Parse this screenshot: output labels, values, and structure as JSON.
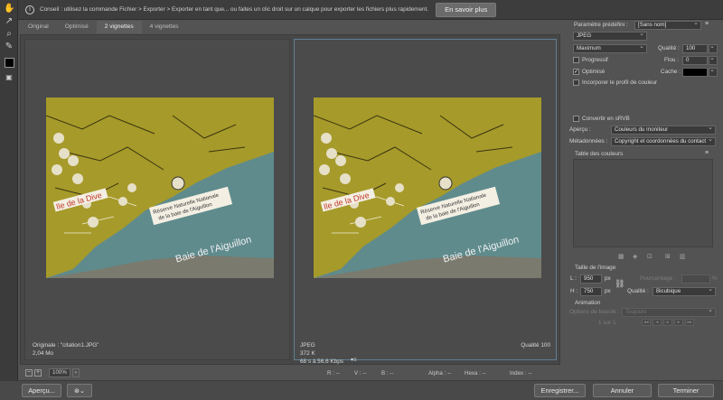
{
  "infobar": {
    "message": "Conseil : utilisez la commande Fichier > Exporter > Exporter en tant que... ou faites un clic droit sur un calque pour exporter les fichiers plus rapidement.",
    "learn_more": "En savoir plus"
  },
  "tabs": [
    "Original",
    "Optimisé",
    "2 vignettes",
    "4 vignettes"
  ],
  "active_tab": "2 vignettes",
  "photo": {
    "label_ile": "Ile de la Dive",
    "label_reserve_1": "Réserve Naturelle Nationale",
    "label_reserve_2": "de la baie de l'Aiguillon",
    "label_baie": "Baie de l'Aiguillon"
  },
  "left_pane": {
    "line1": "Originale : \"citation1.JPG\"",
    "line2": "2,04 Mo"
  },
  "right_pane": {
    "format": "JPEG",
    "size": "372 K",
    "rate": "68 s à 56,6 Kbps",
    "quality": "Qualité 100"
  },
  "status": {
    "zoom": "100%",
    "r": "R : --",
    "v": "V : --",
    "b": "B : --",
    "alpha": "Alpha : --",
    "hexa": "Hexa : --",
    "index": "Index : --"
  },
  "footer": {
    "preview": "Aperçu...",
    "save": "Enregistrer...",
    "cancel": "Annuler",
    "done": "Terminer"
  },
  "panel": {
    "preset_label": "Paramètre prédéfini :",
    "preset_value": "[Sans nom]",
    "format": "JPEG",
    "compression": "Maximum",
    "quality_label": "Qualité :",
    "quality_value": "100",
    "progressive": "Progressif",
    "progressive_checked": false,
    "blur_label": "Flou :",
    "blur_value": "0",
    "optimized": "Optimisé",
    "optimized_checked": true,
    "matte_label": "Cache :",
    "embed_profile": "Incorporer le profil de couleur",
    "embed_checked": false,
    "srgb": "Convertir en sRVB",
    "srgb_checked": false,
    "preview_label": "Aperçu :",
    "preview_value": "Couleurs du moniteur",
    "metadata_label": "Métadonnées :",
    "metadata_value": "Copyright et coordonnées du contact",
    "color_table": "Table des couleurs",
    "image_size": "Taille de l'image",
    "w_label": "L :",
    "w_value": "950",
    "h_label": "H :",
    "h_value": "750",
    "px": "px",
    "percent_label": "Pourcentage :",
    "percent_unit": "%",
    "quality2_label": "Qualité :",
    "quality2_value": "Bicubique",
    "animation": "Animation",
    "loop_label": "Options de boucle :",
    "loop_value": "Toujours",
    "frame_counter": "1 sur 1"
  },
  "colors": {
    "matte": "#000000",
    "accent_border": "#5f7f94"
  }
}
